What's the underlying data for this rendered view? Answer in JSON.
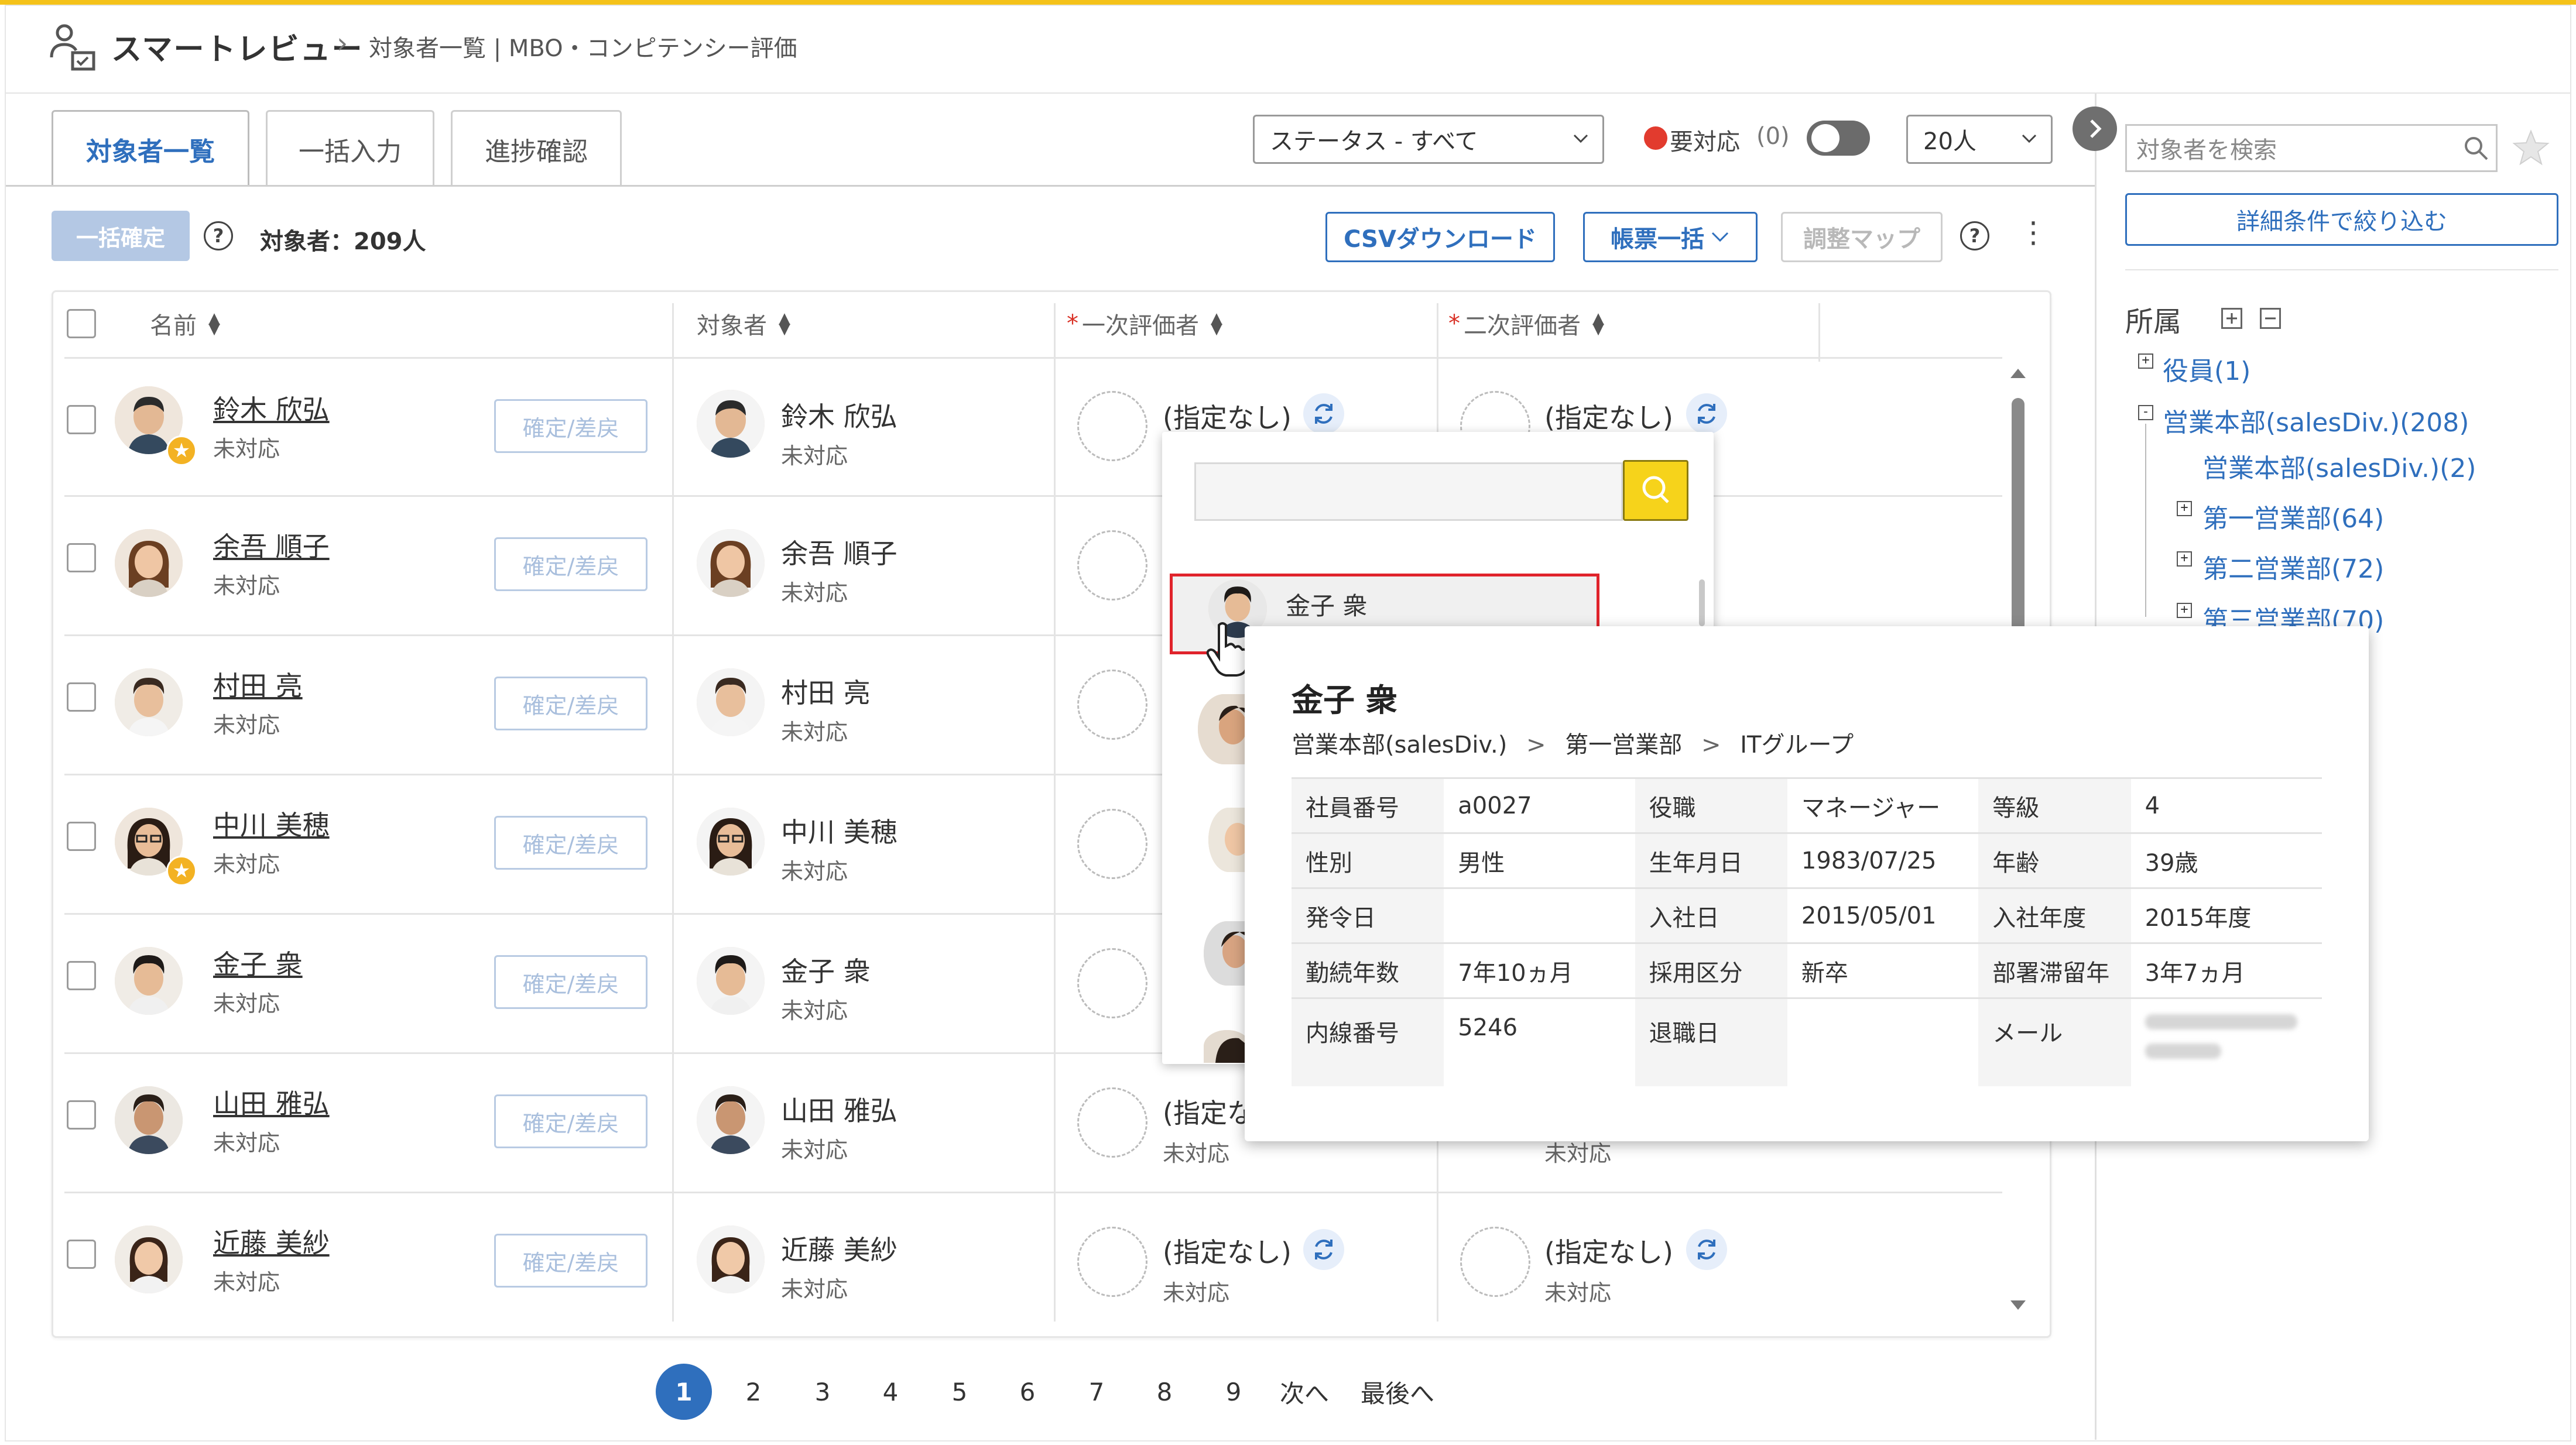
{
  "header": {
    "app_title": "スマートレビュー",
    "breadcrumb": "対象者一覧 | MBO・コンピテンシー評価"
  },
  "tabs": [
    {
      "label": "対象者一覧"
    },
    {
      "label": "一括入力"
    },
    {
      "label": "進捗確認"
    }
  ],
  "filters": {
    "status": "ステータス - すべて",
    "action_required": "要対応",
    "action_required_count": "(0)",
    "per_page": "20人"
  },
  "toolbar": {
    "bulk_confirm": "一括確定",
    "target_count": "対象者：209人",
    "csv_download": "CSVダウンロード",
    "form_bulk": "帳票一括",
    "adjust_map": "調整マップ"
  },
  "columns": {
    "name": "名前",
    "target": "対象者",
    "first_evaluator": "一次評価者",
    "second_evaluator": "二次評価者",
    "required_mark": "*"
  },
  "rows": [
    {
      "name": "鈴木 欣弘",
      "status": "未対応",
      "button": "確定/差戻",
      "first": "(指定なし)",
      "second": "(指定なし)",
      "star": true
    },
    {
      "name": "余吾 順子",
      "status": "未対応",
      "button": "確定/差戻",
      "first": "",
      "second": "",
      "star": false
    },
    {
      "name": "村田 亮",
      "status": "未対応",
      "button": "確定/差戻",
      "first": "",
      "second": "",
      "star": false
    },
    {
      "name": "中川 美穂",
      "status": "未対応",
      "button": "確定/差戻",
      "first": "",
      "second": "",
      "star": true
    },
    {
      "name": "金子 衆",
      "status": "未対応",
      "button": "確定/差戻",
      "first": "",
      "second": "",
      "star": false
    },
    {
      "name": "山田 雅弘",
      "status": "未対応",
      "button": "確定/差戻",
      "first": "(指定な",
      "first_status": "未対応",
      "second_status": "未対応",
      "star": false
    },
    {
      "name": "近藤 美紗",
      "status": "未対応",
      "button": "確定/差戻",
      "first": "(指定なし)",
      "first_status": "未対応",
      "second": "(指定なし)",
      "second_status": "未対応",
      "star": false
    }
  ],
  "pagination": {
    "pages": [
      "1",
      "2",
      "3",
      "4",
      "5",
      "6",
      "7",
      "8",
      "9"
    ],
    "current": "1",
    "next": "次へ",
    "last": "最後へ"
  },
  "sidebar": {
    "search_placeholder": "対象者を検索",
    "filter_button": "詳細条件で絞り込む",
    "dept_title": "所属",
    "tree": [
      {
        "label": "役員(1)",
        "toggle": "+"
      },
      {
        "label": "営業本部(salesDiv.)(208)",
        "toggle": "-"
      },
      {
        "label": "営業本部(salesDiv.)(2)",
        "toggle": ""
      },
      {
        "label": "第一営業部(64)",
        "toggle": "+"
      },
      {
        "label": "第二営業部(72)",
        "toggle": "+"
      },
      {
        "label": "第三営業部(70)",
        "toggle": "+"
      }
    ]
  },
  "dropdown": {
    "search_value": "",
    "highlighted_item": "金子 衆"
  },
  "popup": {
    "name": "金子 衆",
    "path": [
      "営業本部(salesDiv.)",
      "第一営業部",
      "ITグループ"
    ],
    "path_sep": ">",
    "rows": [
      [
        {
          "k": "社員番号",
          "v": "a0027"
        },
        {
          "k": "役職",
          "v": "マネージャー"
        },
        {
          "k": "等級",
          "v": "4"
        }
      ],
      [
        {
          "k": "性別",
          "v": "男性"
        },
        {
          "k": "生年月日",
          "v": "1983/07/25"
        },
        {
          "k": "年齢",
          "v": "39歳"
        }
      ],
      [
        {
          "k": "発令日",
          "v": ""
        },
        {
          "k": "入社日",
          "v": "2015/05/01"
        },
        {
          "k": "入社年度",
          "v": "2015年度"
        }
      ],
      [
        {
          "k": "勤続年数",
          "v": "7年10ヵ月"
        },
        {
          "k": "採用区分",
          "v": "新卒"
        },
        {
          "k": "部署滞留年",
          "v": "3年7ヵ月"
        }
      ],
      [
        {
          "k": "内線番号",
          "v": "5246"
        },
        {
          "k": "退職日",
          "v": ""
        },
        {
          "k": "メール",
          "v": ""
        }
      ]
    ]
  },
  "colors": {
    "accent": "#2f6fbd",
    "top_bar": "#f4c21a",
    "alert_red": "#e23b2e",
    "highlight_border": "#e0232b",
    "search_button": "#f6d31b"
  }
}
